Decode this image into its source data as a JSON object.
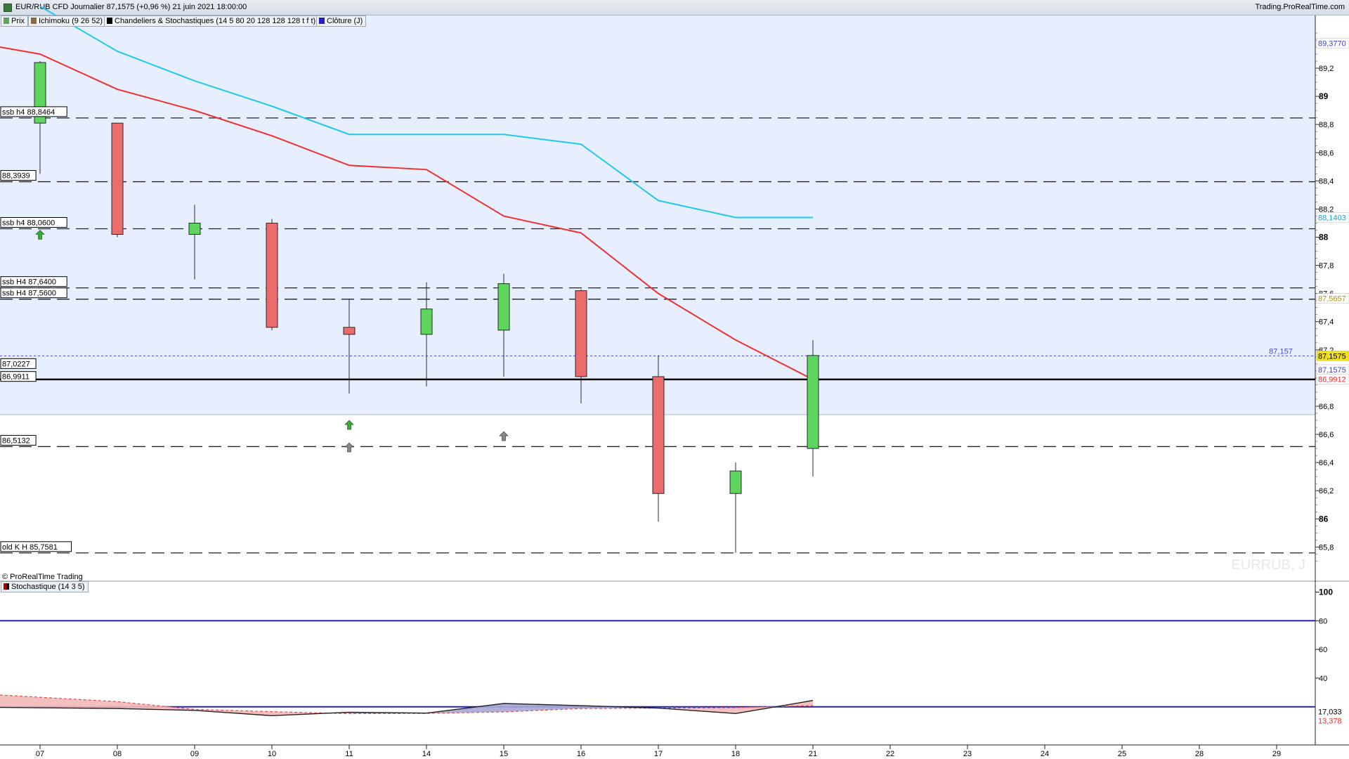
{
  "header": {
    "title": "EUR/RUB CFD Journalier 87,1575 (+0,96 %) 21 juin 2021 18:00:00",
    "site": "Trading.ProRealTime.com"
  },
  "legend": [
    {
      "label": "Prix",
      "color": "#5aa55a"
    },
    {
      "label": "Ichimoku (9 26 52)",
      "color": "#8a6a3a"
    },
    {
      "label": "Chandeliers & Stochastiques (14 5 80 20 128 128 128 t f t)",
      "color": "#000000"
    },
    {
      "label": "Clôture (J)",
      "color": "#2020c0"
    }
  ],
  "watermark": "EURRUB, J",
  "copyright": "© ProRealTime Trading",
  "stoch_legend": "Stochastique (14 3 5)",
  "colors": {
    "cloud": "#e7efff",
    "bull": "#5ed65e",
    "bear": "#ec6b6b",
    "tenkan": "#f03030",
    "kijun": "#22c8ec",
    "close_line": "#000000",
    "level80": "#2020c0"
  },
  "chart_data": {
    "type": "candlestick",
    "x_ticks": [
      "07",
      "08",
      "09",
      "10",
      "11",
      "14",
      "15",
      "16",
      "17",
      "18",
      "21",
      "22",
      "23",
      "24",
      "25",
      "28",
      "29"
    ],
    "ylim": [
      85.6,
      89.5
    ],
    "y_ticks": [
      "89,2",
      "89",
      "88,8",
      "88,6",
      "88,4",
      "88,2",
      "88",
      "87,8",
      "87,6",
      "87,4",
      "87,2",
      "87",
      "86,8",
      "86,6",
      "86,4",
      "86,2",
      "86",
      "85,8"
    ],
    "bold_y_ticks": [
      "89",
      "88",
      "86"
    ],
    "candles": [
      {
        "date": "07",
        "open": 88.81,
        "high": 89.25,
        "low": 88.45,
        "close": 89.24
      },
      {
        "date": "08",
        "open": 88.81,
        "high": 88.81,
        "low": 88.0,
        "close": 88.02
      },
      {
        "date": "09",
        "open": 88.02,
        "high": 88.23,
        "low": 87.7,
        "close": 88.1
      },
      {
        "date": "10",
        "open": 88.1,
        "high": 88.13,
        "low": 87.34,
        "close": 87.36
      },
      {
        "date": "11",
        "open": 87.36,
        "high": 87.56,
        "low": 86.89,
        "close": 87.31
      },
      {
        "date": "14",
        "open": 87.31,
        "high": 87.68,
        "low": 86.94,
        "close": 87.49
      },
      {
        "date": "15",
        "open": 87.34,
        "high": 87.74,
        "low": 87.01,
        "close": 87.67
      },
      {
        "date": "16",
        "open": 87.62,
        "high": 87.63,
        "low": 86.82,
        "close": 87.01
      },
      {
        "date": "17",
        "open": 87.01,
        "high": 87.16,
        "low": 85.98,
        "close": 86.18
      },
      {
        "date": "18",
        "open": 86.18,
        "high": 86.4,
        "low": 85.76,
        "close": 86.34
      },
      {
        "date": "21",
        "open": 86.5,
        "high": 87.27,
        "low": 86.3,
        "close": 87.16
      }
    ],
    "tenkan": [
      89.35,
      89.3,
      89.05,
      88.9,
      88.72,
      88.51,
      88.48,
      88.15,
      88.03,
      87.6,
      87.27,
      86.99
    ],
    "kijun": [
      89.64,
      89.32,
      89.11,
      88.93,
      88.73,
      88.73,
      88.73,
      88.66,
      88.26,
      88.14,
      88.14
    ],
    "cloud_bottom": 86.74,
    "levels": [
      {
        "label": "ssb h4 88,8464",
        "value": 88.8464
      },
      {
        "label": "88,3939",
        "value": 88.3939
      },
      {
        "label": "ssb h4 88,0600",
        "value": 88.06
      },
      {
        "label": "ssb H4 87,6400",
        "value": 87.64
      },
      {
        "label": "ssb H4 87,5600",
        "value": 87.56
      },
      {
        "label": "86,9911",
        "value": 86.9911
      },
      {
        "label": "87,0227",
        "value": 87.0227
      },
      {
        "label": "86,5132",
        "value": 86.5132
      },
      {
        "label": "old K H 85,7581",
        "value": 85.7581
      }
    ],
    "close_level": 86.99,
    "last_price_line": {
      "value": 87.157,
      "label": "87,157"
    },
    "right_tags": [
      {
        "text": "89,3770",
        "value": 89.377,
        "color": "#4040c0",
        "bg": "#ffffff"
      },
      {
        "text": "88,1403",
        "value": 88.1403,
        "color": "#1aa0c8",
        "bg": "#ffffff"
      },
      {
        "text": "87,5657",
        "value": 87.5657,
        "color": "#b09020",
        "bg": "#ffffff"
      },
      {
        "text": "87,1575",
        "value": 87.1575,
        "color": "#000000",
        "bg": "#f0e020"
      },
      {
        "text": "87,1575",
        "value": 87.06,
        "color": "#4040c0",
        "bg": "#ffffff"
      },
      {
        "text": "86,9912",
        "value": 86.9912,
        "color": "#e03030",
        "bg": "#ffffff"
      }
    ],
    "arrows": [
      {
        "date": "07",
        "value": 88.02,
        "color": "#30b030"
      },
      {
        "date": "11",
        "value": 86.67,
        "color": "#30b030"
      },
      {
        "date": "11",
        "value": 86.51,
        "color": "#888888"
      },
      {
        "date": "15",
        "value": 86.59,
        "color": "#888888"
      }
    ],
    "stochastic": {
      "ylim": [
        0,
        110
      ],
      "y_ticks": [
        "100",
        "80",
        "60",
        "40"
      ],
      "upper_level": 80,
      "lower_level": 20,
      "k": [
        19.6,
        18.8,
        17.5,
        13.8,
        16.2,
        15.6,
        22.3,
        20.8,
        19.1,
        15.3,
        24.4
      ],
      "d": [
        28.2,
        23.6,
        18.2,
        16.6,
        15.2,
        15.4,
        16.4,
        18.8,
        19.1,
        19.4,
        20.8
      ],
      "k_last": "17,033",
      "d_last": "13,378"
    }
  }
}
